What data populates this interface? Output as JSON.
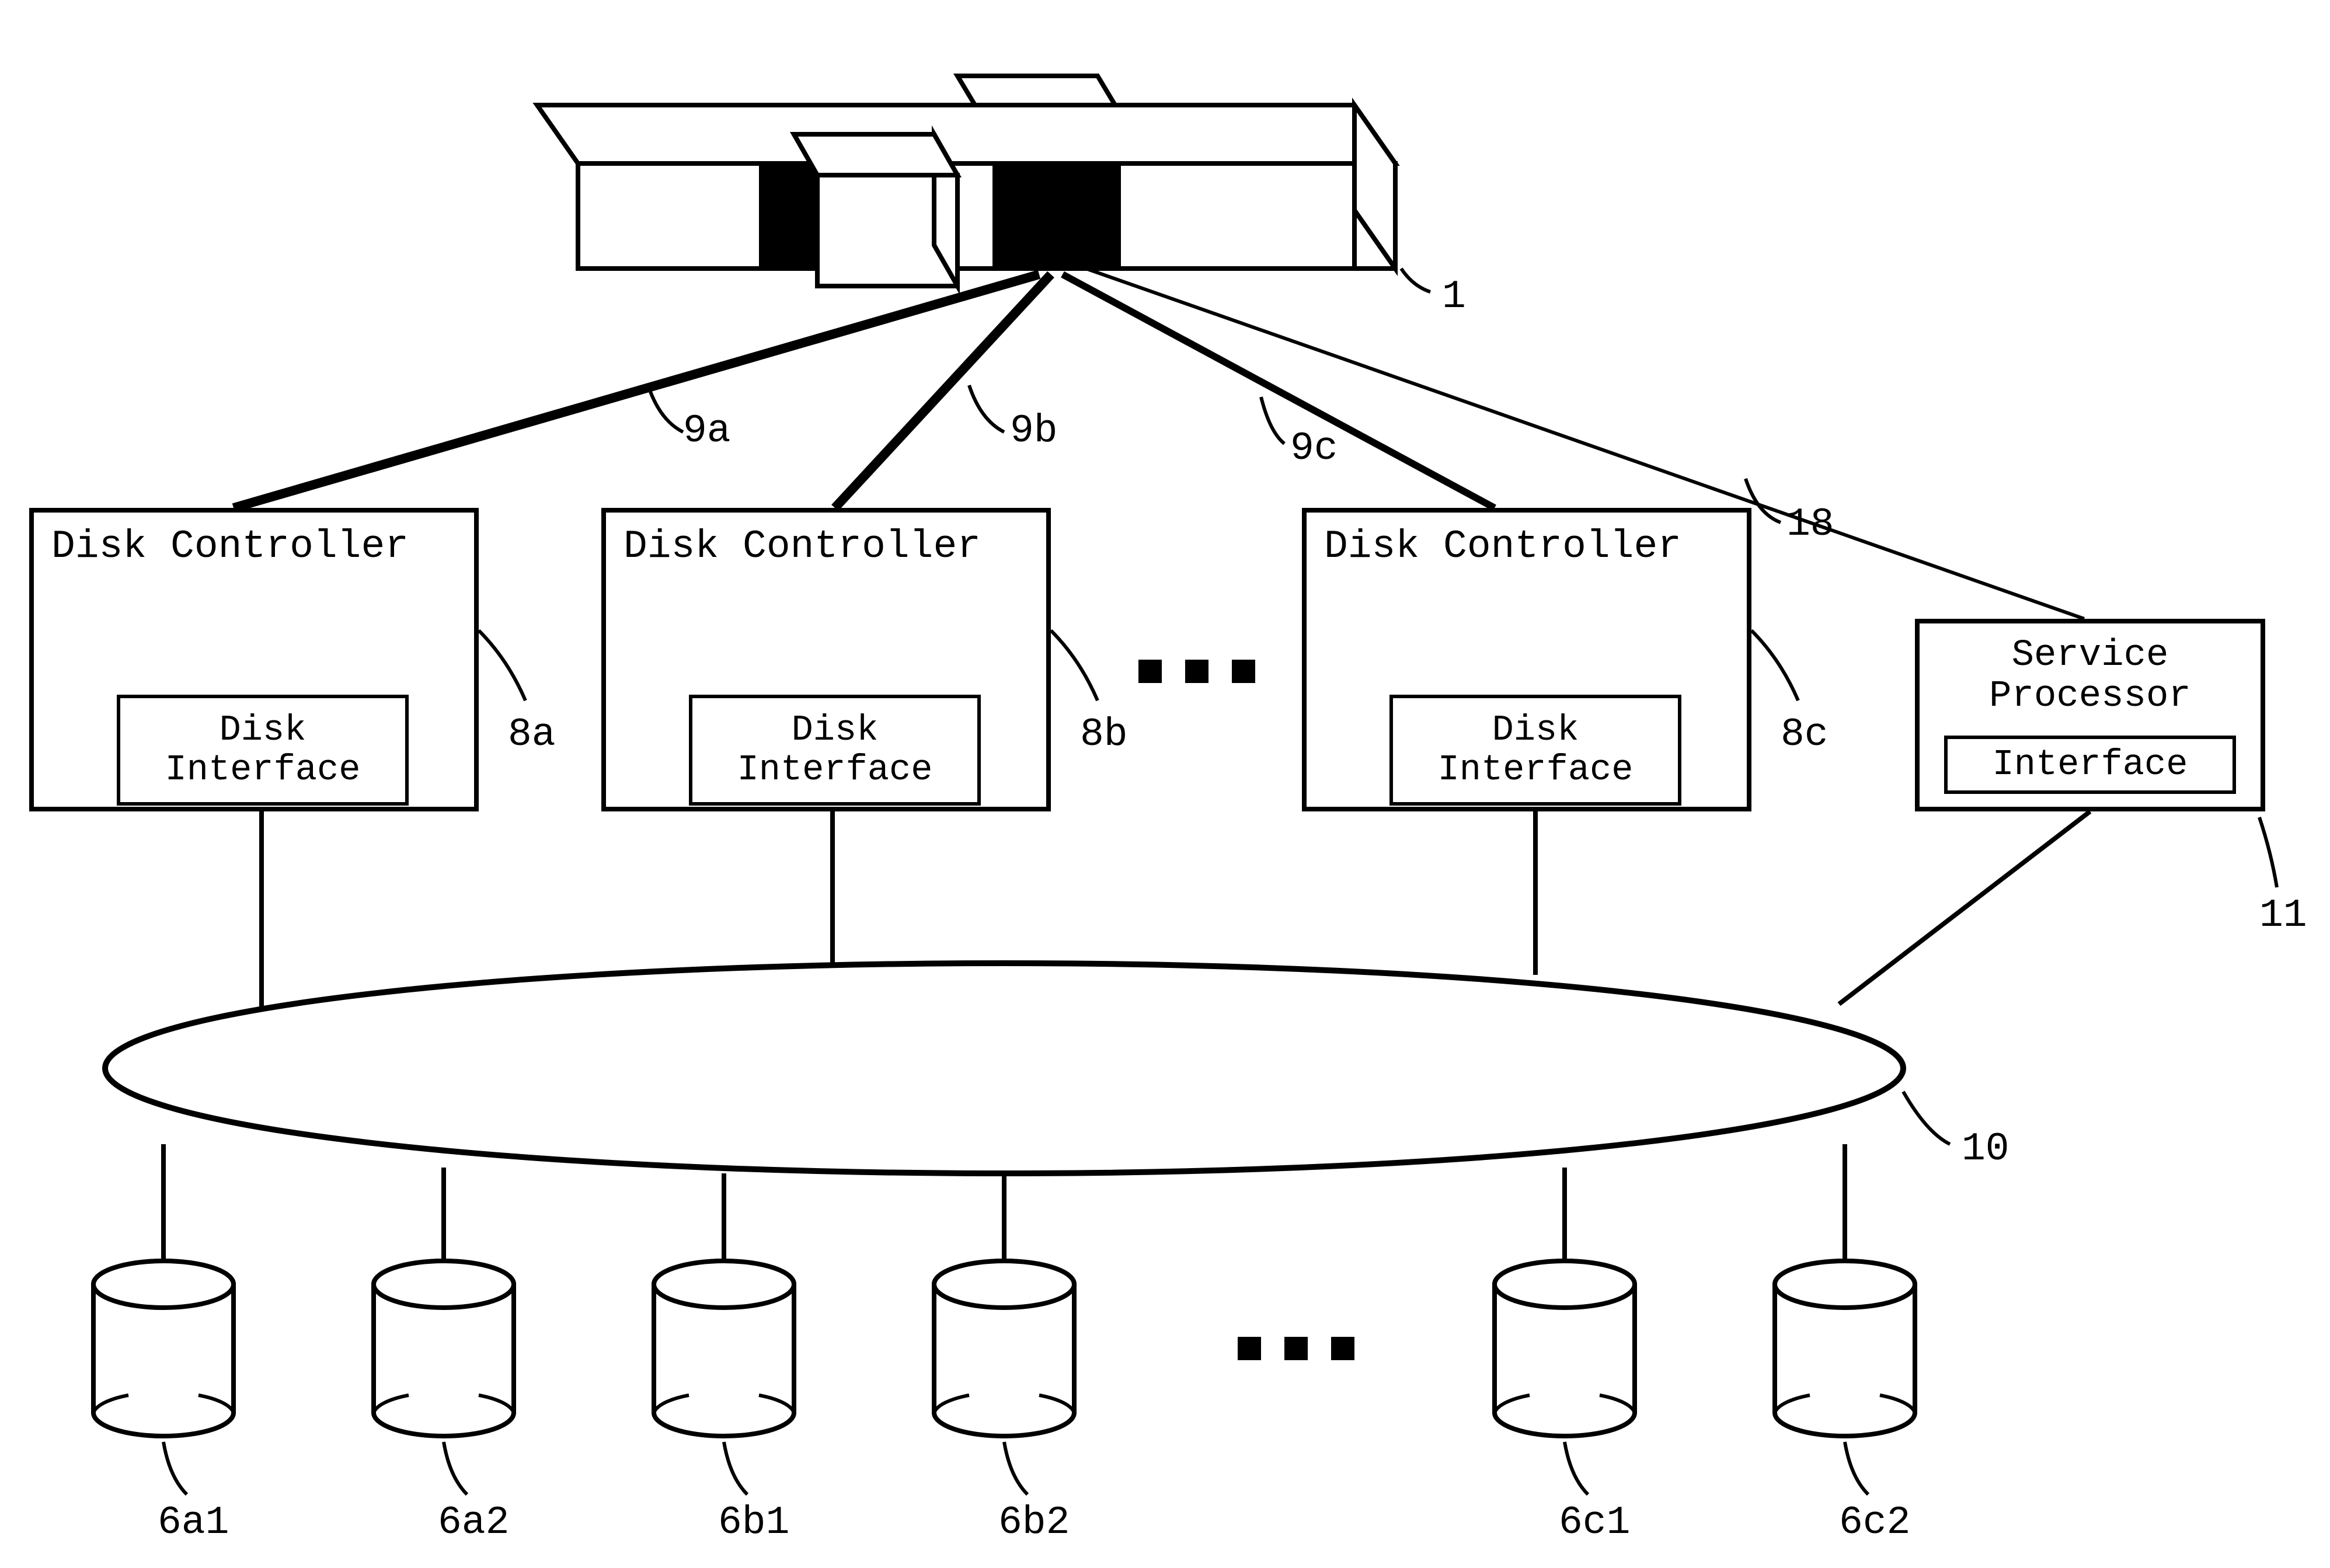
{
  "device_ref": "1",
  "links_host": [
    "9a",
    "9b",
    "9c",
    "18"
  ],
  "controllers": [
    {
      "title": "Disk Controller",
      "iface": "Disk\nInterface",
      "ref": "8a"
    },
    {
      "title": "Disk Controller",
      "iface": "Disk\nInterface",
      "ref": "8b"
    },
    {
      "title": "Disk Controller",
      "iface": "Disk\nInterface",
      "ref": "8c"
    }
  ],
  "service_processor": {
    "title": "Service\nProcessor",
    "iface": "Interface",
    "ref": "11"
  },
  "bus_ref": "10",
  "disks": [
    "6a1",
    "6a2",
    "6b1",
    "6b2",
    "6c1",
    "6c2"
  ]
}
